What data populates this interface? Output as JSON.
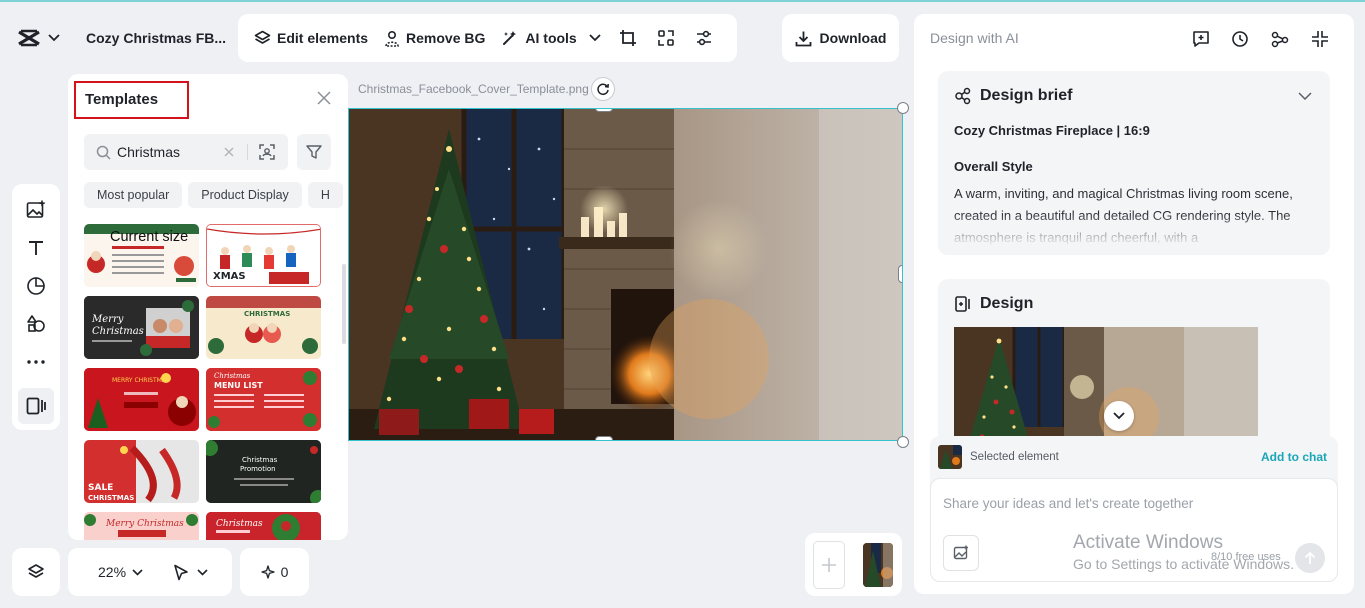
{
  "header": {
    "project_title": "Cozy Christmas FB...",
    "toolbar": {
      "edit_elements": "Edit elements",
      "remove_bg": "Remove BG",
      "ai_tools": "AI tools"
    },
    "download": "Download"
  },
  "templates_panel": {
    "title": "Templates",
    "search_value": "Christmas",
    "chips": [
      "Most popular",
      "Product Display",
      "H"
    ],
    "current_size": "Current size",
    "thumbnails": [
      {
        "name": "christmas-menu-card",
        "text": ""
      },
      {
        "name": "xmas-capcut-mall",
        "text": "XMAS"
      },
      {
        "name": "merry-christmas-photo",
        "text": "Merry Christmas"
      },
      {
        "name": "christmas-family-photo",
        "text": "CHRISTMAS"
      },
      {
        "name": "merry-christmas-red-banner",
        "text": "MERRY CHRISTMAS"
      },
      {
        "name": "christmas-menu-list",
        "text": "Christmas MENU LIST"
      },
      {
        "name": "sale-christmas",
        "text": "SALE CHRISTMAS"
      },
      {
        "name": "christmas-promotion",
        "text": "Christmas Promotion"
      },
      {
        "name": "merry-christmas-special-sale",
        "text": "Merry Christmas"
      },
      {
        "name": "christmas-red-card",
        "text": "Christmas"
      }
    ]
  },
  "canvas": {
    "filename": "Christmas_Facebook_Cover_Template.png",
    "zoom": "22%",
    "ai_credits": "0"
  },
  "right_panel": {
    "title": "Design with AI",
    "brief": {
      "heading": "Design brief",
      "subtitle": "Cozy Christmas Fireplace | 16:9",
      "section": "Overall Style",
      "text": "A warm, inviting, and magical Christmas living room scene, created in a beautiful and detailed CG rendering style. The atmosphere is tranquil and cheerful, with a"
    },
    "design_heading": "Design",
    "chat": {
      "selected_label": "Selected element",
      "add_to_chat": "Add to chat",
      "placeholder": "Share your ideas and let's create together",
      "usage": "8/10 free uses"
    }
  },
  "watermark": {
    "line1": "Activate Windows",
    "line2": "Go to Settings to activate Windows."
  },
  "colors": {
    "accent": "#1aa6b7",
    "highlight_border": "#d3121b",
    "selection": "#35c2cf"
  }
}
